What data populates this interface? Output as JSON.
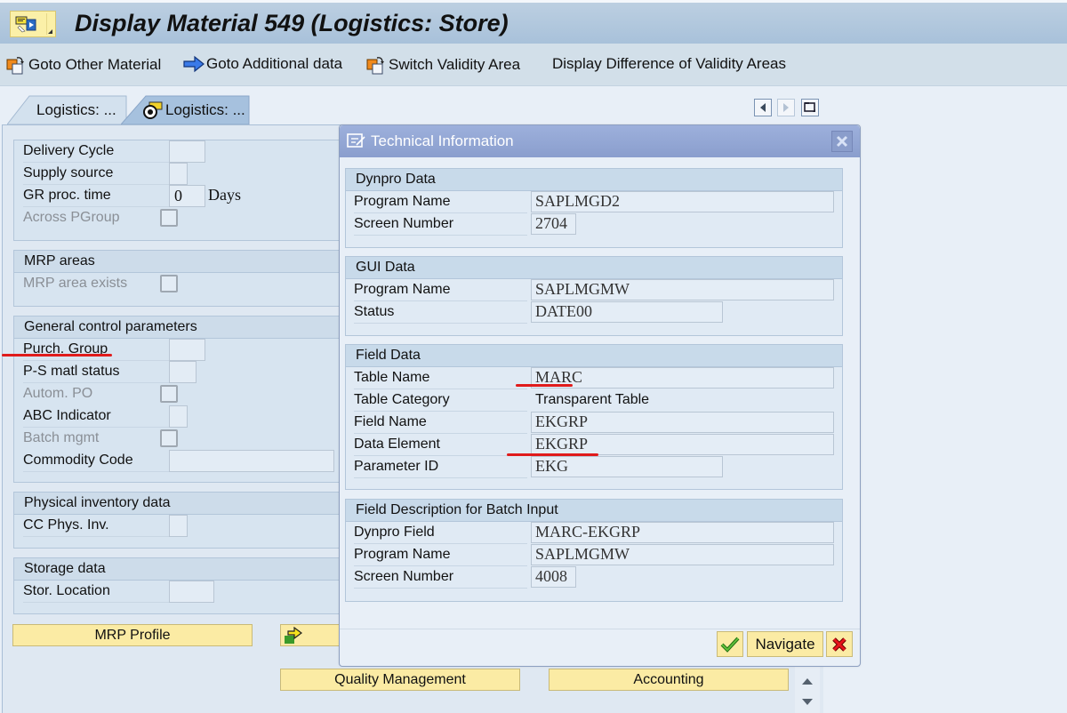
{
  "window": {
    "title": "Display Material 549 (Logistics: Store)"
  },
  "toolbar": {
    "items": [
      {
        "label": "Goto Other Material",
        "icon": "copy-switch-icon"
      },
      {
        "label": "Goto Additional data",
        "icon": "arrow-right-icon"
      },
      {
        "label": "Switch Validity Area",
        "icon": "copy-switch-icon"
      },
      {
        "label": "Display Difference of Validity Areas",
        "icon": null
      }
    ]
  },
  "tabs": [
    {
      "label": "Logistics: ...",
      "active": false
    },
    {
      "label": "Logistics: ...",
      "active": true,
      "icon": "plant-storage-icon"
    }
  ],
  "tab_nav": {
    "prev": "scroll-left-icon",
    "next": "scroll-right-icon",
    "list": "tab-list-icon"
  },
  "main": {
    "group1": {
      "rows": [
        {
          "label": "Delivery Cycle",
          "value": "",
          "type": "input"
        },
        {
          "label": "Supply source",
          "value": "",
          "type": "input"
        },
        {
          "label": "GR proc. time",
          "value": "0",
          "unit": "Days",
          "type": "input"
        },
        {
          "label": "Across PGroup",
          "checked": false,
          "type": "checkbox",
          "disabled": true
        }
      ]
    },
    "mrp_areas": {
      "title": "MRP areas",
      "rows": [
        {
          "label": "MRP area exists",
          "checked": false,
          "type": "checkbox",
          "disabled": true
        }
      ]
    },
    "general_control": {
      "title": "General control parameters",
      "rows": [
        {
          "label": "Purch. Group",
          "value": "",
          "type": "input"
        },
        {
          "label": "P-S matl status",
          "value": "",
          "type": "input"
        },
        {
          "label": "Autom. PO",
          "checked": false,
          "type": "checkbox",
          "disabled": true
        },
        {
          "label": "ABC Indicator",
          "value": "",
          "type": "input"
        },
        {
          "label": "Batch mgmt",
          "checked": false,
          "type": "checkbox",
          "disabled": true
        },
        {
          "label": "Commodity Code",
          "value": "",
          "type": "input"
        }
      ]
    },
    "physical_inventory": {
      "title": "Physical inventory data",
      "rows": [
        {
          "label": "CC Phys. Inv.",
          "value": "",
          "type": "input"
        }
      ]
    },
    "storage": {
      "title": "Storage data",
      "rows": [
        {
          "label": "Stor. Location",
          "value": "",
          "type": "input"
        }
      ]
    },
    "buttons": {
      "mrp_profile": "MRP Profile",
      "quality_management": "Quality Management",
      "accounting": "Accounting"
    }
  },
  "dialog": {
    "title": "Technical Information",
    "dynpro": {
      "title": "Dynpro Data",
      "program_name_label": "Program Name",
      "program_name": "SAPLMGD2",
      "screen_number_label": "Screen Number",
      "screen_number": "2704"
    },
    "gui": {
      "title": "GUI Data",
      "program_name_label": "Program Name",
      "program_name": "SAPLMGMW",
      "status_label": "Status",
      "status": "DATE00"
    },
    "field": {
      "title": "Field Data",
      "table_name_label": "Table Name",
      "table_name": "MARC",
      "table_category_label": "Table Category",
      "table_category": "Transparent Table",
      "field_name_label": "Field Name",
      "field_name": "EKGRP",
      "data_element_label": "Data Element",
      "data_element": "EKGRP",
      "parameter_id_label": "Parameter ID",
      "parameter_id": "EKG"
    },
    "batch": {
      "title": "Field Description for Batch Input",
      "dynpro_field_label": "Dynpro Field",
      "dynpro_field": "MARC-EKGRP",
      "program_name_label": "Program Name",
      "program_name": "SAPLMGMW",
      "screen_number_label": "Screen Number",
      "screen_number": "4008"
    },
    "buttons": {
      "navigate": "Navigate"
    }
  },
  "annotations": {
    "highlight_color": "#e01b1b"
  }
}
